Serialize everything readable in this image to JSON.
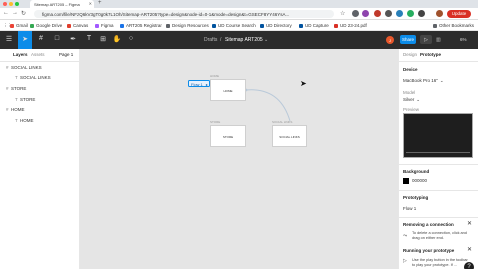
{
  "browser": {
    "tab_title": "Sitemap ART205 – Figma",
    "new_tab": "+",
    "url": "figma.com/file/NFzQ6kV3gT0g0k7L1Oh/Sitemap-ART205?type=design&node-id=0-1&mode=design&t=GSECF8YY46YsA...",
    "update_label": "Update",
    "bookmarks": [
      "Gmail",
      "Google Drive",
      "Canvas",
      "Figma",
      "ART205 Registrar",
      "Design Resources",
      "UD Course Search",
      "UD Directory",
      "UD Capture",
      "UD 23-24.pdf"
    ],
    "other_bookmarks": "Other Bookmarks",
    "colors": {
      "update": "#d93025",
      "toolbar": "#2c2c2c",
      "accent": "#0c8ce9"
    }
  },
  "figma_toolbar": {
    "breadcrumb_folder": "Drafts",
    "breadcrumb_sep": "/",
    "file_name": "Sitemap ART205",
    "avatar_initial": "J",
    "share_label": "Share",
    "zoom": "6%"
  },
  "left_panel": {
    "tab_layers": "Layers",
    "tab_assets": "Assets",
    "page": "Page 1",
    "layers": [
      {
        "name": "SOCIAL LINKS",
        "type": "frame"
      },
      {
        "name": "SOCIAL LINKS",
        "type": "text"
      },
      {
        "name": "STORE",
        "type": "frame"
      },
      {
        "name": "STORE",
        "type": "text"
      },
      {
        "name": "HOME",
        "type": "frame"
      },
      {
        "name": "HOME",
        "type": "text"
      }
    ]
  },
  "canvas": {
    "flow_label": "Flow 1",
    "frames": {
      "home": {
        "label": "HOME",
        "text": "HOME"
      },
      "store": {
        "label": "STORE",
        "text": "STORE"
      },
      "social": {
        "label": "SOCIAL LINKS",
        "text": "SOCIAL LINKS"
      }
    }
  },
  "right_panel": {
    "tab_design": "Design",
    "tab_prototype": "Prototype",
    "device_heading": "Device",
    "device_value": "MacBook Pro 16\"",
    "model_heading": "Model",
    "model_value": "Silver",
    "preview_heading": "Preview",
    "background_heading": "Background",
    "background_value": "000000",
    "prototyping_heading": "Prototyping",
    "flow_name": "Flow 1",
    "tip1_title": "Removing a connection",
    "tip1_body": "To delete a connection, click and drag on either end.",
    "tip2_title": "Running your prototype",
    "tip2_body": "Use the play button in the toolbar to play your prototype. If ...",
    "help": "?"
  }
}
